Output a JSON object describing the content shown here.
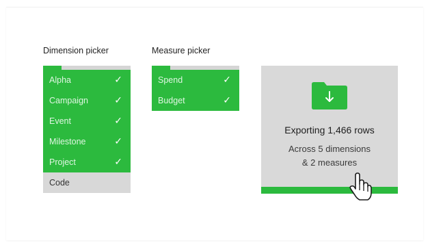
{
  "dimension_picker": {
    "title": "Dimension picker",
    "items": [
      {
        "label": "Alpha",
        "selected": true
      },
      {
        "label": "Campaign",
        "selected": true
      },
      {
        "label": "Event",
        "selected": true
      },
      {
        "label": "Milestone",
        "selected": true
      },
      {
        "label": "Project",
        "selected": true
      },
      {
        "label": "Code",
        "selected": false
      }
    ]
  },
  "measure_picker": {
    "title": "Measure picker",
    "items": [
      {
        "label": "Spend",
        "selected": true
      },
      {
        "label": "Budget",
        "selected": true
      }
    ]
  },
  "export_card": {
    "title": "Exporting 1,466 rows",
    "subtitle_line1": "Across 5 dimensions",
    "subtitle_line2": "& 2 measures",
    "icon": "folder-download-icon"
  },
  "icons": {
    "check": "checkmark-icon",
    "cursor": "hand-pointer-icon"
  },
  "colors": {
    "accent_green": "#2cba3e",
    "card_gray": "#d9d9d9",
    "unselected_gray": "#d8d8d8"
  }
}
